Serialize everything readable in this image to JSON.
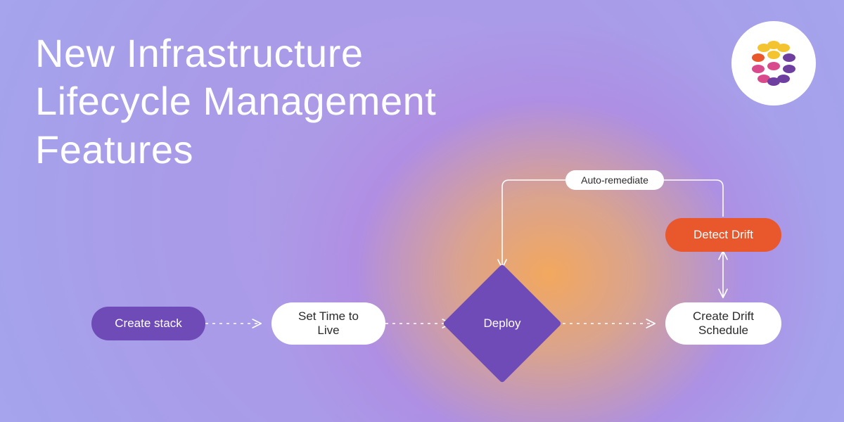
{
  "title": {
    "line1_pre": "New ",
    "line1_bold": "Infrastructure",
    "line2_bold": "Lifecycle Management",
    "line3": "Features"
  },
  "nodes": {
    "create_stack": "Create stack",
    "set_ttl": "Set Time to Live",
    "deploy": "Deploy",
    "create_drift_schedule": "Create Drift Schedule",
    "detect_drift": "Detect Drift",
    "auto_remediate": "Auto-remediate"
  },
  "colors": {
    "purple": "#6f4bb8",
    "orange": "#e8582c",
    "white": "#ffffff"
  }
}
